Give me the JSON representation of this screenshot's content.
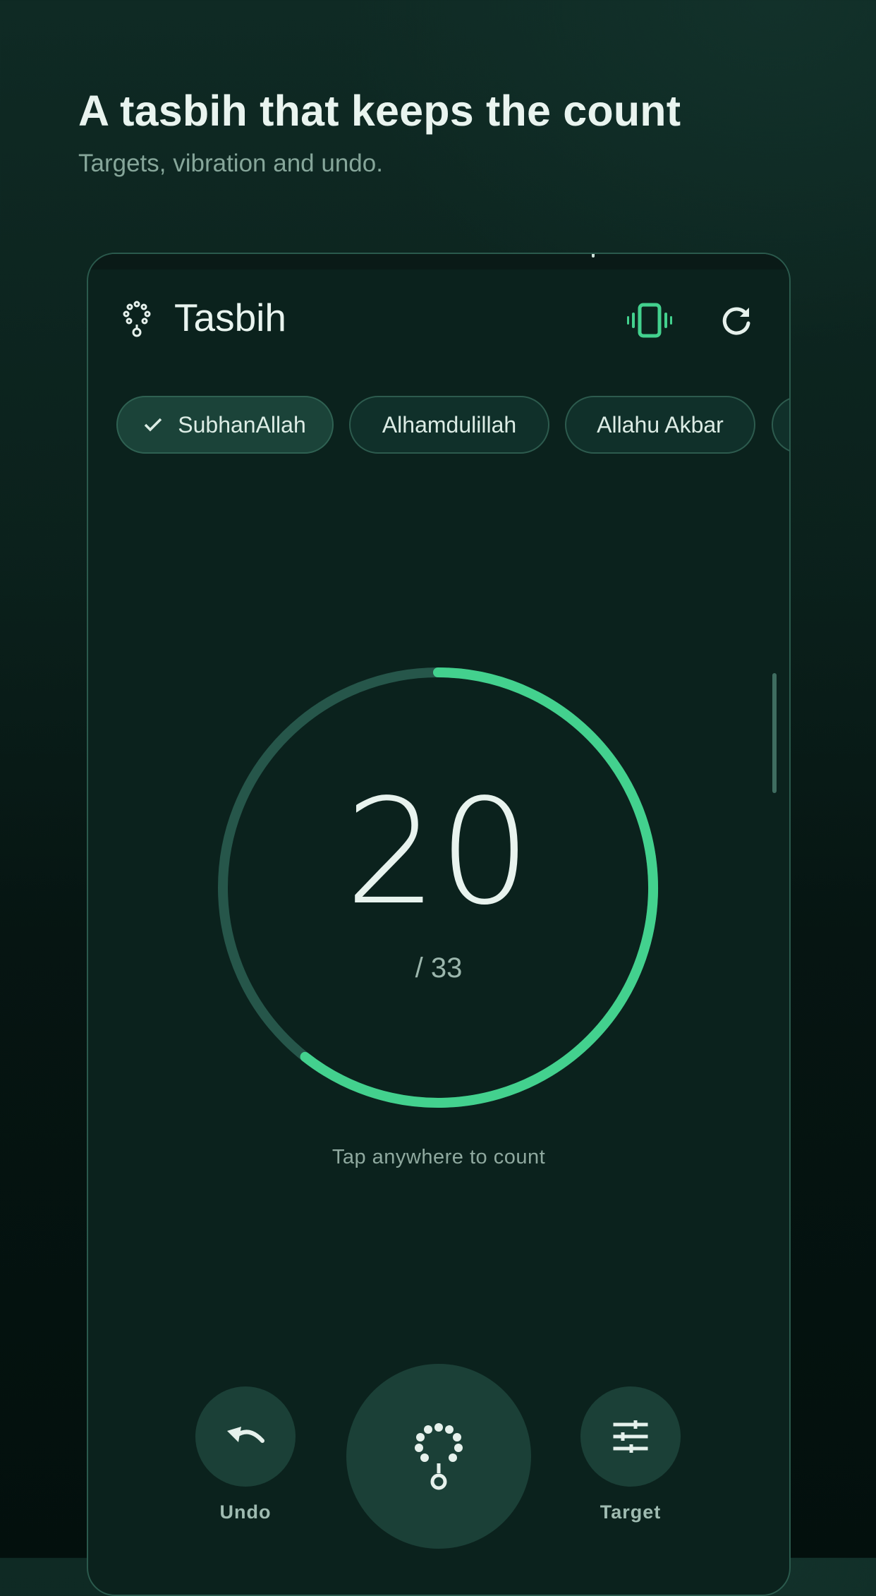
{
  "promo": {
    "headline": "A tasbih that keeps the count",
    "subline": "Targets, vibration and undo."
  },
  "app": {
    "title": "Tasbih",
    "icons": {
      "app": "prayer-beads-icon",
      "vibrate": "vibrate-icon",
      "reset": "refresh-icon"
    }
  },
  "chips": [
    {
      "label": "SubhanAllah",
      "selected": true
    },
    {
      "label": "Alhamdulillah",
      "selected": false
    },
    {
      "label": "Allahu Akbar",
      "selected": false
    }
  ],
  "counter": {
    "count": "20",
    "target": "/ 33",
    "progress_fraction": 0.606,
    "hint": "Tap anywhere to count"
  },
  "actions": {
    "undo_label": "Undo",
    "target_label": "Target"
  },
  "colors": {
    "accent": "#43d18e",
    "track": "#26564a",
    "background": "#0b221d"
  }
}
